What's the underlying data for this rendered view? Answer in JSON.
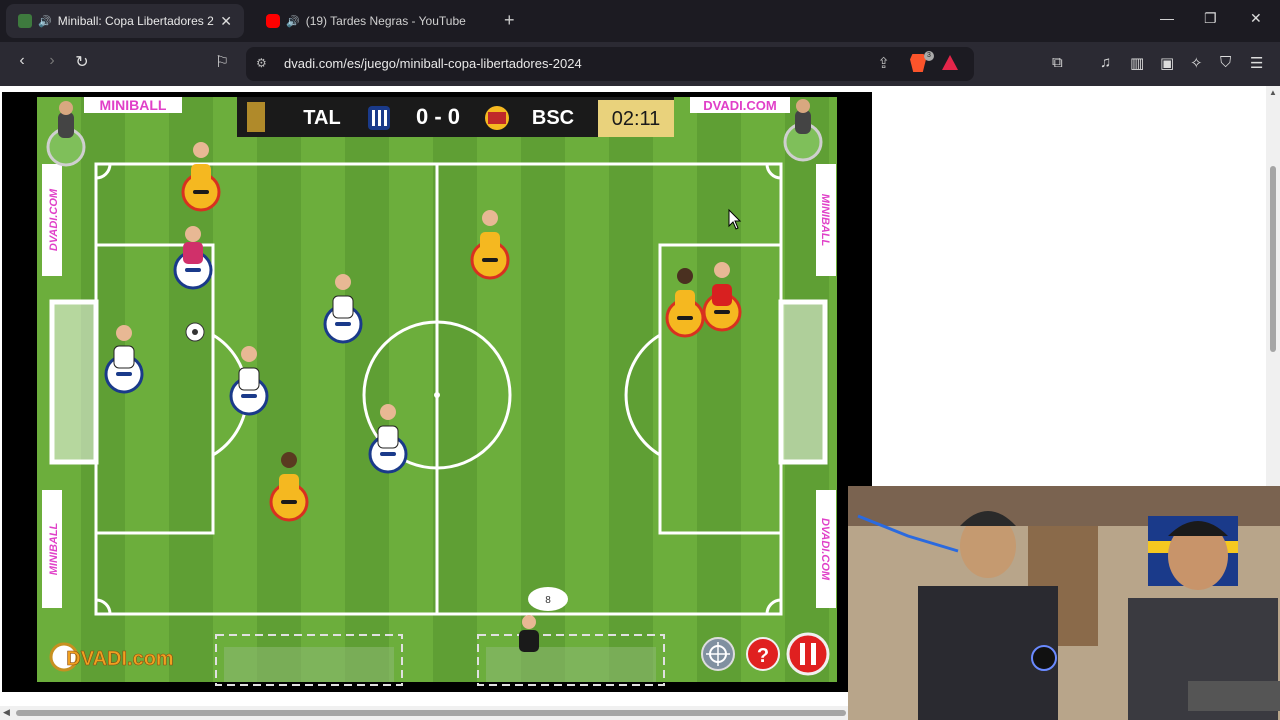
{
  "tabs": [
    {
      "title": "Miniball: Copa Libertadores 2",
      "favicon_color": "#4a8a4a"
    },
    {
      "title": "(19) Tardes Negras - YouTube",
      "favicon_color": "#ff0000"
    }
  ],
  "url": "dvadi.com/es/juego/miniball-copa-libertadores-2024",
  "brave_count": "3",
  "game": {
    "brand_left": "MINIBALL",
    "brand_right": "DVADI.COM",
    "side_left_top": "DVADI.COM",
    "side_left_bottom": "MINIBALL",
    "side_right_top": "MINIBALL",
    "side_right_bottom": "DVADI.COM",
    "home_team": "TAL",
    "away_team": "BSC",
    "score": "0 - 0",
    "clock": "02:11",
    "player_number": "8",
    "logo_text": "DVADI.com",
    "help_glyph": "?",
    "colors": {
      "pitch_light": "#6cae3c",
      "pitch_dark": "#5f9f34",
      "home_kit": "#ffffff",
      "away_kit": "#f5b820",
      "timer_bg": "#e9d27c",
      "brand_pink": "#e040c8"
    }
  }
}
